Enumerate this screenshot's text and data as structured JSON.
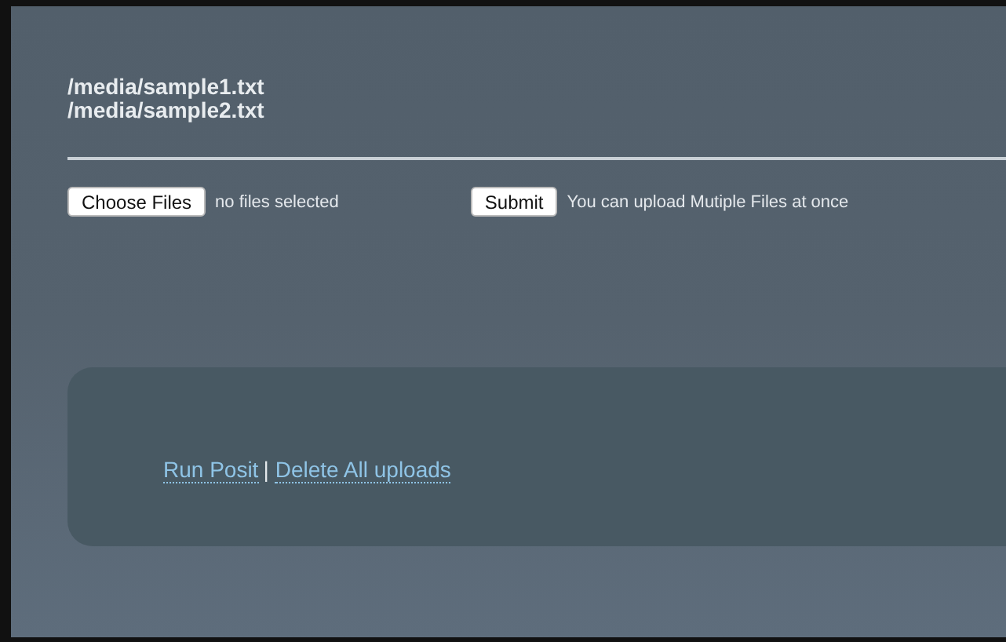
{
  "files": [
    "/media/sample1.txt",
    "/media/sample2.txt"
  ],
  "upload": {
    "choose_button": "Choose Files",
    "file_status": "no files selected",
    "submit_button": "Submit",
    "hint": "You can upload Mutiple Files at once"
  },
  "links": {
    "items": [
      "Run Posit",
      "Delete All uploads"
    ],
    "separator": "|"
  }
}
